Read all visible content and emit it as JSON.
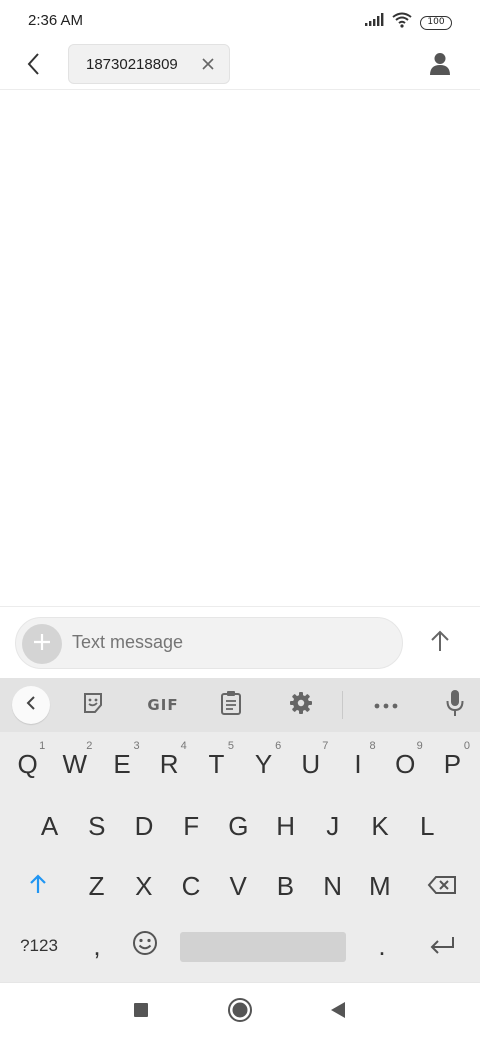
{
  "status_bar": {
    "time": "2:36 AM",
    "battery": "100",
    "icons": [
      "signal-icon",
      "wifi-icon",
      "battery-icon"
    ]
  },
  "header": {
    "back_icon": "chevron-left-icon",
    "recipient": "18730218809",
    "remove_icon": "close-icon",
    "contact_icon": "person-icon"
  },
  "compose": {
    "placeholder": "Text message",
    "add_icon": "plus-icon",
    "send_icon": "arrow-up-icon"
  },
  "keyboard": {
    "toolbar": {
      "items": [
        "chevron-left-icon",
        "sticker-icon",
        "GIF",
        "clipboard-icon",
        "gear-icon",
        "more-icon",
        "microphone-icon"
      ]
    },
    "row1": [
      {
        "label": "Q",
        "hint": "1"
      },
      {
        "label": "W",
        "hint": "2"
      },
      {
        "label": "E",
        "hint": "3"
      },
      {
        "label": "R",
        "hint": "4"
      },
      {
        "label": "T",
        "hint": "5"
      },
      {
        "label": "Y",
        "hint": "6"
      },
      {
        "label": "U",
        "hint": "7"
      },
      {
        "label": "I",
        "hint": "8"
      },
      {
        "label": "O",
        "hint": "9"
      },
      {
        "label": "P",
        "hint": "0"
      }
    ],
    "row2": [
      "A",
      "S",
      "D",
      "F",
      "G",
      "H",
      "J",
      "K",
      "L"
    ],
    "row3": [
      "Z",
      "X",
      "C",
      "V",
      "B",
      "N",
      "M"
    ],
    "row4": {
      "symbols": "?123",
      "comma": ",",
      "period": "."
    },
    "accent_color": "#2196F3"
  },
  "nav_bar": {
    "icons": [
      "recents-square-icon",
      "home-circle-icon",
      "back-triangle-icon"
    ]
  }
}
